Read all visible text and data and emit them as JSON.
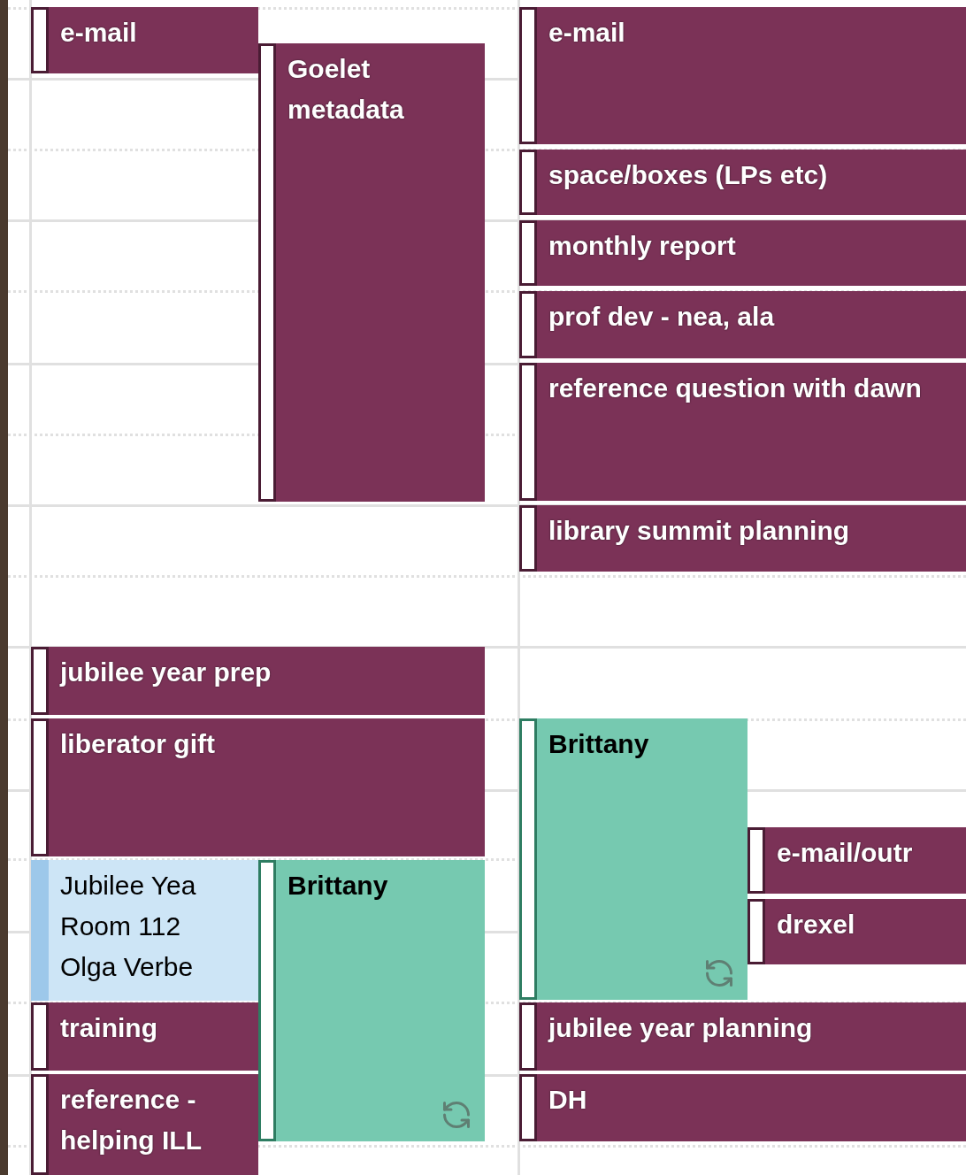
{
  "days": [
    {
      "events": [
        {
          "kind": "task",
          "title": "e-mail",
          "color": "#7b3257",
          "recurring": false
        },
        {
          "kind": "task",
          "title": "Goelet metadata",
          "color": "#7b3257",
          "recurring": false
        },
        {
          "kind": "task",
          "title": "jubilee year prep",
          "color": "#7b3257",
          "recurring": false
        },
        {
          "kind": "task",
          "title": "liberator gift",
          "color": "#7b3257",
          "recurring": false
        },
        {
          "kind": "meeting",
          "title": "Jubilee Yea",
          "location": "Room 112",
          "organizer": "Olga Verbe",
          "color": "#cde5f6",
          "recurring": false
        },
        {
          "kind": "appointment",
          "title": "Brittany",
          "color": "#76c9b0",
          "recurring": true
        },
        {
          "kind": "task",
          "title": "training",
          "color": "#7b3257",
          "recurring": false
        },
        {
          "kind": "task",
          "title": "reference - helping ILL",
          "color": "#7b3257",
          "recurring": false
        }
      ]
    },
    {
      "events": [
        {
          "kind": "task",
          "title": "e-mail",
          "color": "#7b3257",
          "recurring": false
        },
        {
          "kind": "task",
          "title": "space/boxes (LPs etc)",
          "color": "#7b3257",
          "recurring": false
        },
        {
          "kind": "task",
          "title": "monthly report",
          "color": "#7b3257",
          "recurring": false
        },
        {
          "kind": "task",
          "title": "prof dev - nea, ala",
          "color": "#7b3257",
          "recurring": false
        },
        {
          "kind": "task",
          "title": "reference question with dawn",
          "color": "#7b3257",
          "recurring": false
        },
        {
          "kind": "task",
          "title": "library summit planning",
          "color": "#7b3257",
          "recurring": false
        },
        {
          "kind": "appointment",
          "title": "Brittany",
          "color": "#76c9b0",
          "recurring": true
        },
        {
          "kind": "task",
          "title": "e-mail/outr",
          "color": "#7b3257",
          "recurring": false
        },
        {
          "kind": "task",
          "title": "drexel",
          "color": "#7b3257",
          "recurring": false
        },
        {
          "kind": "task",
          "title": "jubilee year planning",
          "color": "#7b3257",
          "recurring": false
        },
        {
          "kind": "task",
          "title": "DH",
          "color": "#7b3257",
          "recurring": false
        }
      ]
    }
  ]
}
